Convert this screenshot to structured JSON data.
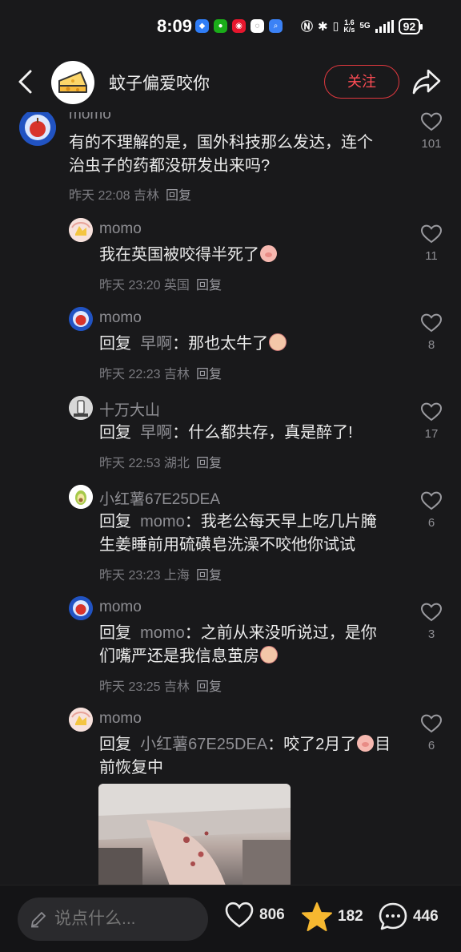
{
  "status_bar": {
    "time": "8:09",
    "net_speed_top": "1.6",
    "net_speed_bottom": "K/s",
    "network": "5G",
    "battery": "92",
    "app_icons": [
      "shield-app-icon",
      "wechat-icon",
      "weibo-icon",
      "chat-app-icon",
      "search-app-icon"
    ]
  },
  "header": {
    "title": "蚊子偏爱咬你",
    "follow_label": "关注"
  },
  "comments": [
    {
      "name": "momo",
      "text": "有的不理解的是，国外科技那么发达，连个治虫子的药都没研发出来吗?",
      "line1": "有的不理解的是，国外科技那么发达，连个",
      "line2": "治虫子的药都没研发出来吗?",
      "time": "昨天 22:08 吉林",
      "reply_label": "回复",
      "likes": "101"
    },
    {
      "name": "momo",
      "text": "我在英国被咬得半死了",
      "time": "昨天 23:20 英国",
      "reply_label": "回复",
      "likes": "11"
    },
    {
      "name": "momo",
      "reply_prefix": "回复",
      "reply_to": "早啊",
      "text": "：那也太牛了",
      "time": "昨天 22:23 吉林",
      "reply_label": "回复",
      "likes": "8"
    },
    {
      "name": "十万大山",
      "reply_prefix": "回复",
      "reply_to": "早啊",
      "text": "：什么都共存，真是醉了!",
      "time": "昨天 22:53 湖北",
      "reply_label": "回复",
      "likes": "17"
    },
    {
      "name": "小红薯67E25DEA",
      "reply_prefix": "回复",
      "reply_to": "momo",
      "text": "：我老公每天早上吃几片腌",
      "text2": "生姜睡前用硫磺皂洗澡不咬他你试试",
      "time": "昨天 23:23 上海",
      "reply_label": "回复",
      "likes": "6"
    },
    {
      "name": "momo",
      "reply_prefix": "回复",
      "reply_to": "momo",
      "text": "：之前从来没听说过，是你",
      "text2": "们嘴严还是我信息茧房",
      "time": "昨天 23:25 吉林",
      "reply_label": "回复",
      "likes": "3"
    },
    {
      "name": "momo",
      "reply_prefix": "回复",
      "reply_to": "小红薯67E25DEA",
      "text": "：咬了2月了",
      "text_after": "目",
      "text2": "前恢复中",
      "likes": "6"
    }
  ],
  "bottom_bar": {
    "input_placeholder": "说点什么...",
    "like_count": "806",
    "star_count": "182",
    "comment_count": "446"
  },
  "colors": {
    "background": "#19191b",
    "accent_red": "#ff4d55",
    "secondary_text": "#8e8e93"
  }
}
